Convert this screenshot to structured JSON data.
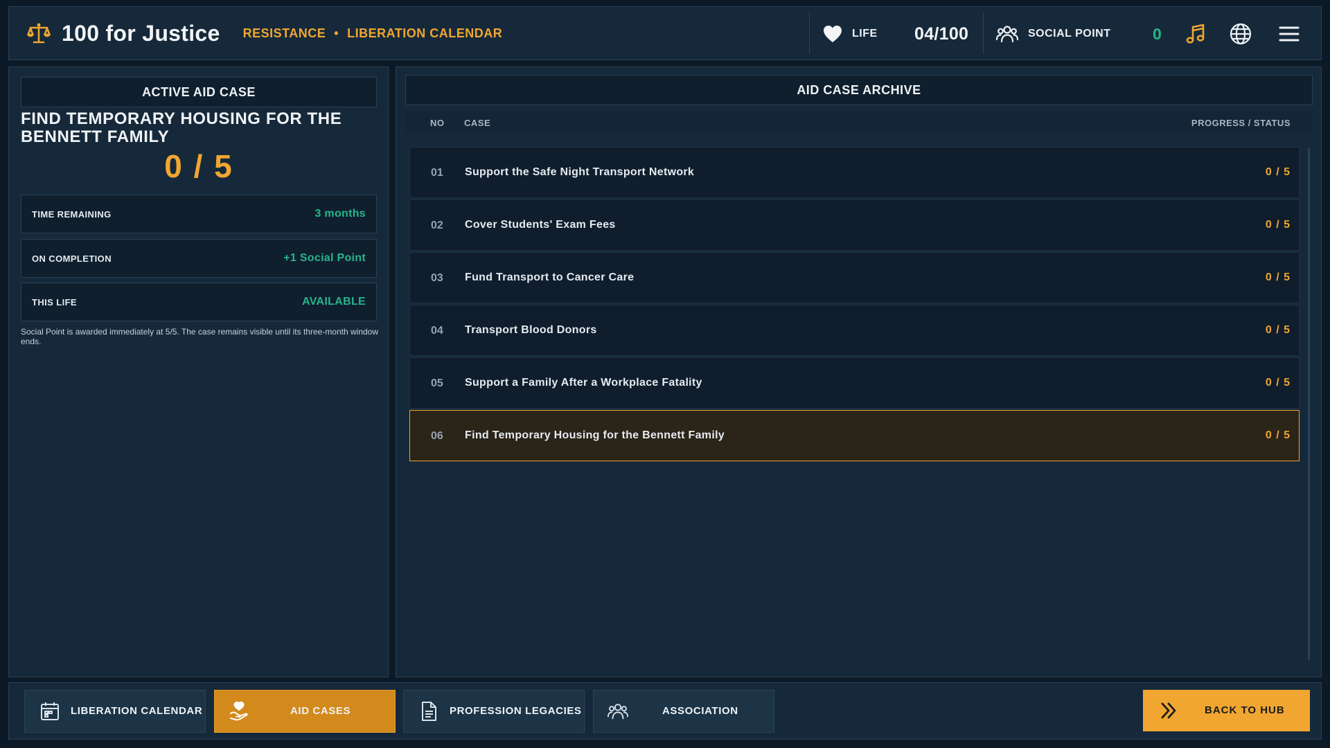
{
  "header": {
    "app_title": "100 for Justice",
    "breadcrumb": [
      "RESISTANCE",
      "LIBERATION CALENDAR"
    ],
    "breadcrumb_separator": "•",
    "life_label": "LIFE",
    "life_value": "04/100",
    "social_point_label": "SOCIAL POINT",
    "social_point_value": "0",
    "icons": [
      "scales-icon",
      "heart-icon",
      "people-icon",
      "music-icon",
      "globe-icon",
      "menu-icon"
    ]
  },
  "active_case": {
    "header": "ACTIVE AID CASE",
    "title": "FIND TEMPORARY HOUSING FOR THE BENNETT FAMILY",
    "progress": "0 / 5",
    "rows": [
      {
        "label": "TIME REMAINING",
        "value": "3 months"
      },
      {
        "label": "ON COMPLETION",
        "value": "+1 Social Point"
      },
      {
        "label": "THIS LIFE",
        "value": "AVAILABLE"
      }
    ],
    "note": "Social Point is awarded immediately at 5/5. The case remains visible until its three-month window ends."
  },
  "archive": {
    "header": "AID CASE ARCHIVE",
    "columns": {
      "no": "NO",
      "case": "CASE",
      "status": "PROGRESS / STATUS"
    },
    "rows": [
      {
        "no": "01",
        "name": "Support the Safe Night Transport Network",
        "progress": "0 / 5",
        "selected": false
      },
      {
        "no": "02",
        "name": "Cover Students' Exam Fees",
        "progress": "0 / 5",
        "selected": false
      },
      {
        "no": "03",
        "name": "Fund Transport to Cancer Care",
        "progress": "0 / 5",
        "selected": false
      },
      {
        "no": "04",
        "name": "Transport Blood Donors",
        "progress": "0 / 5",
        "selected": false
      },
      {
        "no": "05",
        "name": "Support a Family After a Workplace Fatality",
        "progress": "0 / 5",
        "selected": false
      },
      {
        "no": "06",
        "name": "Find Temporary Housing for the Bennett Family",
        "progress": "0 / 5",
        "selected": true
      }
    ]
  },
  "bottom_nav": {
    "items": [
      {
        "label": "LIBERATION CALENDAR",
        "icon": "calendar-icon",
        "active": false
      },
      {
        "label": "AID CASES",
        "icon": "hand-heart-icon",
        "active": true
      },
      {
        "label": "PROFESSION LEGACIES",
        "icon": "document-icon",
        "active": false
      },
      {
        "label": "ASSOCIATION",
        "icon": "people-icon",
        "active": false
      }
    ],
    "back_label": "BACK TO HUB",
    "back_icon": "double-chevron-right-icon"
  },
  "colors": {
    "accent": "#f0a631",
    "positive": "#27b58b",
    "background": "#0c1a27",
    "panel": "#16293a"
  }
}
